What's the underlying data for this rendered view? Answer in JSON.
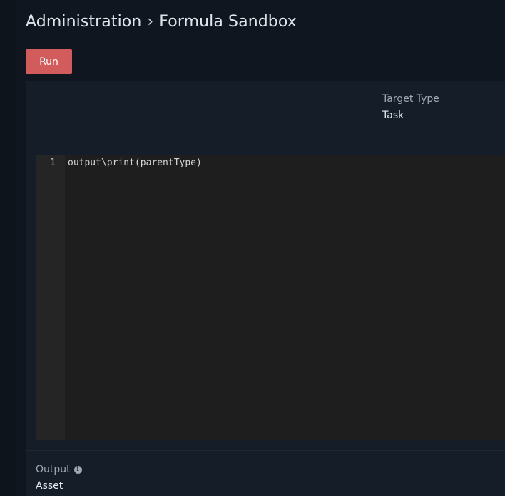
{
  "header": {
    "breadcrumb_parent": "Administration",
    "breadcrumb_separator": "›",
    "breadcrumb_current": "Formula Sandbox"
  },
  "toolbar": {
    "run_label": "Run"
  },
  "settings": {
    "target_type_label": "Target Type",
    "target_type_value": "Task"
  },
  "editor": {
    "lines": [
      {
        "number": "1",
        "code": "output\\print(parentType)"
      }
    ]
  },
  "output": {
    "label": "Output",
    "info_icon": "info-circle-icon",
    "value": "Asset"
  },
  "colors": {
    "background": "#0f1620",
    "panel": "#141d28",
    "run_button": "#d25b5b",
    "editor_background": "#1e1e1e"
  }
}
